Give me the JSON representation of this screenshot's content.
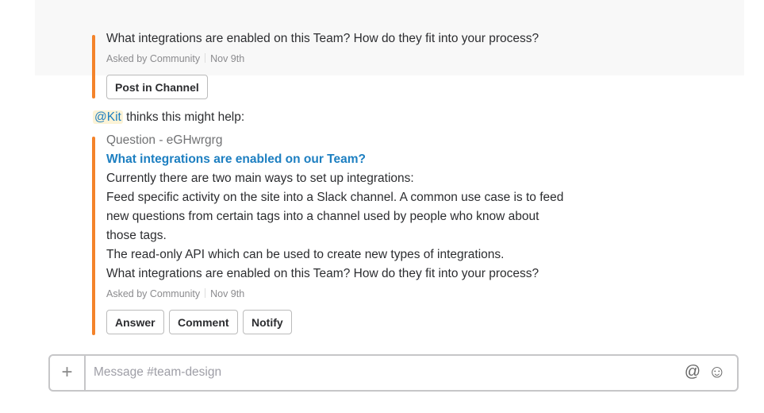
{
  "prev": {
    "question": "What integrations are enabled on this Team? How do they fit into your process?",
    "asked_by": "Asked by Community",
    "date": "Nov 9th",
    "post_button": "Post in Channel"
  },
  "kit": {
    "mention": "@Kit",
    "text": " thinks this might help:"
  },
  "card": {
    "header": "Question - eGHwrgrg",
    "title": "What integrations are enabled on our Team?",
    "lines": [
      "Currently there are two main ways to set up integrations:",
      "Feed specific activity on the site into a Slack channel. A common use case is to feed",
      "new questions from certain tags into a channel used by people who know about",
      "those tags.",
      "The read-only API which can be used to create new types of integrations.",
      "What integrations are enabled on this Team? How do they fit into your process?"
    ],
    "asked_by": "Asked by Community",
    "date": "Nov 9th",
    "buttons": [
      "Answer",
      "Comment",
      "Notify"
    ]
  },
  "composer": {
    "placeholder": "Message #team-design",
    "plus": "+",
    "at": "@",
    "emoji": "☺"
  }
}
